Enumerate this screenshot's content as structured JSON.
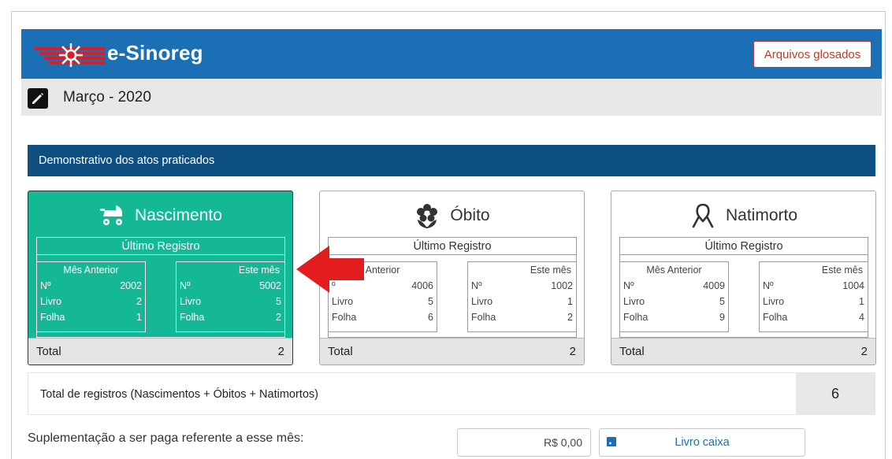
{
  "app": {
    "title": "e-Sinoreg",
    "accent": "#1a6fb5",
    "header_dark": "#0d4f80"
  },
  "header": {
    "glosados_label": "Arquivos glosados"
  },
  "period": {
    "title": "Março - 2020",
    "icon": "edit-icon"
  },
  "section": {
    "title": "Demonstrativo dos atos praticados"
  },
  "cards": [
    {
      "label": "Nascimento",
      "icon": "stroller-icon",
      "active": true,
      "color": "#14b894",
      "reg_title": "Último Registro",
      "prev": {
        "title": "Mês Anterior",
        "rows": [
          {
            "k": "Nº",
            "v": "2002"
          },
          {
            "k": "Livro",
            "v": "2"
          },
          {
            "k": "Folha",
            "v": "1"
          }
        ]
      },
      "curr": {
        "title": "Este mês",
        "rows": [
          {
            "k": "Nº",
            "v": "5002"
          },
          {
            "k": "Livro",
            "v": "5"
          },
          {
            "k": "Folha",
            "v": "2"
          }
        ]
      },
      "total_label": "Total",
      "total_value": "2"
    },
    {
      "label": "Óbito",
      "icon": "flower-icon",
      "active": false,
      "reg_title": "Último Registro",
      "prev": {
        "title": "Anterior",
        "rows": [
          {
            "k": "º",
            "v": "4006"
          },
          {
            "k": "Livro",
            "v": "5"
          },
          {
            "k": "Folha",
            "v": "6"
          }
        ]
      },
      "curr": {
        "title": "Este mês",
        "rows": [
          {
            "k": "Nº",
            "v": "1002"
          },
          {
            "k": "Livro",
            "v": "1"
          },
          {
            "k": "Folha",
            "v": "2"
          }
        ]
      },
      "total_label": "Total",
      "total_value": "2"
    },
    {
      "label": "Natimorto",
      "icon": "ribbon-icon",
      "active": false,
      "reg_title": "Último Registro",
      "prev": {
        "title": "Mês Anterior",
        "rows": [
          {
            "k": "Nº",
            "v": "4009"
          },
          {
            "k": "Livro",
            "v": "5"
          },
          {
            "k": "Folha",
            "v": "9"
          }
        ]
      },
      "curr": {
        "title": "Este mês",
        "rows": [
          {
            "k": "Nº",
            "v": "1004"
          },
          {
            "k": "Livro",
            "v": "1"
          },
          {
            "k": "Folha",
            "v": "4"
          }
        ]
      },
      "total_label": "Total",
      "total_value": "2"
    }
  ],
  "totals": {
    "label": "Total de registros (Nascimentos + Óbitos + Natimortos)",
    "value": "6"
  },
  "supplement": {
    "label": "Suplementação a ser paga referente a esse mês:",
    "value": "R$ 0,00",
    "button_label": "Livro caixa",
    "button_icon": "book-add-icon"
  },
  "annotation": {
    "icon": "red-arrow-icon",
    "color": "#e31d1d"
  }
}
